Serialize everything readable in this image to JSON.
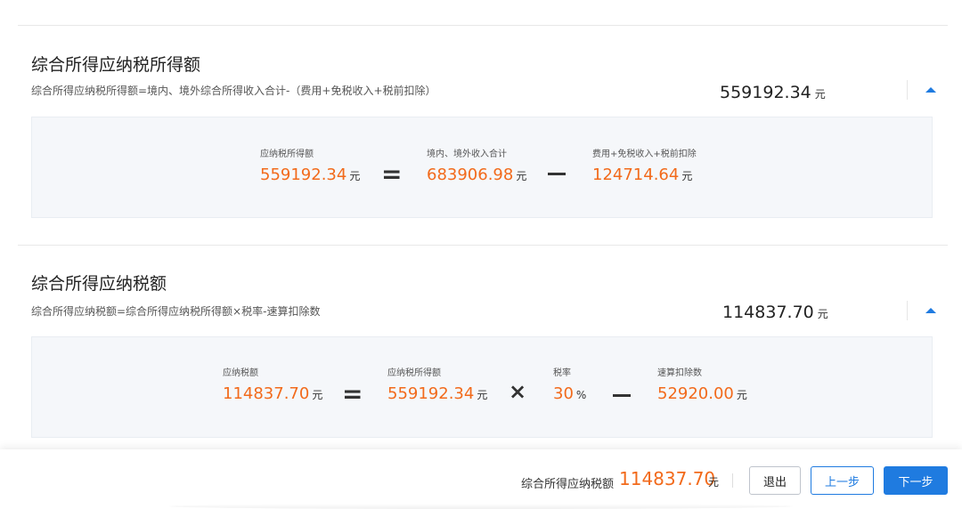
{
  "section1": {
    "title": "综合所得应纳税所得额",
    "formula": "综合所得应纳税所得额=境内、境外综合所得收入合计-（费用+免税收入+税前扣除）",
    "total_value": "559192.34",
    "total_unit": "元",
    "terms": [
      {
        "label": "应纳税所得额",
        "value": "559192.34",
        "unit": "元"
      },
      {
        "label": "境内、境外收入合计",
        "value": "683906.98",
        "unit": "元"
      },
      {
        "label": "费用+免税收入+税前扣除",
        "value": "124714.64",
        "unit": "元"
      }
    ],
    "operators": [
      "=",
      "−"
    ]
  },
  "section2": {
    "title": "综合所得应纳税额",
    "formula": "综合所得应纳税额=综合所得应纳税所得额×税率-速算扣除数",
    "total_value": "114837.70",
    "total_unit": "元",
    "terms": [
      {
        "label": "应纳税额",
        "value": "114837.70",
        "unit": "元"
      },
      {
        "label": "应纳税所得额",
        "value": "559192.34",
        "unit": "元"
      },
      {
        "label": "税率",
        "value": "30",
        "unit": "%"
      },
      {
        "label": "速算扣除数",
        "value": "52920.00",
        "unit": "元"
      }
    ],
    "operators": [
      "=",
      "×",
      "−"
    ]
  },
  "footer": {
    "label": "综合所得应纳税额",
    "value": "114837.70",
    "unit": "元",
    "exit_label": "退出",
    "prev_label": "上一步",
    "next_label": "下一步"
  },
  "colors": {
    "accent": "#1f7be0",
    "amount": "#f26a1b"
  }
}
